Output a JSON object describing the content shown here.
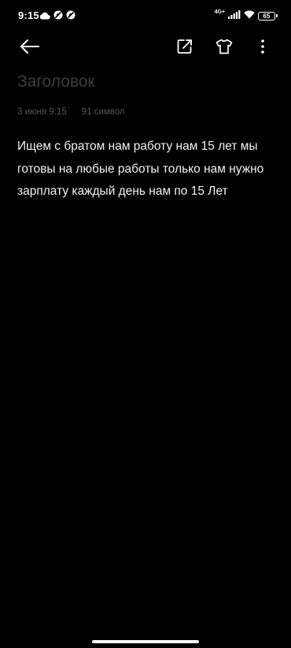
{
  "status_bar": {
    "time": "9:15",
    "network_type": "4G+",
    "battery_level": "65",
    "icons": [
      "cloud-icon",
      "blocked-notification-icon",
      "blocked-notification-icon",
      "signal-icon",
      "wifi-icon",
      "battery-icon"
    ]
  },
  "toolbar": {
    "icons": [
      "back-arrow-icon",
      "share-icon",
      "theme-tshirt-icon",
      "more-vertical-icon"
    ]
  },
  "note": {
    "title_placeholder": "Заголовок",
    "date": "3 июня 9:15",
    "char_count": "91 символ",
    "body": "Ищем с братом нам работу нам 15 лет мы готовы на любые работы только нам нужно зарплату каждый день нам по 15 Лет"
  },
  "colors": {
    "background": "#000000",
    "text": "#f2f2f2",
    "muted": "#555555",
    "placeholder": "#3d3d3d"
  }
}
